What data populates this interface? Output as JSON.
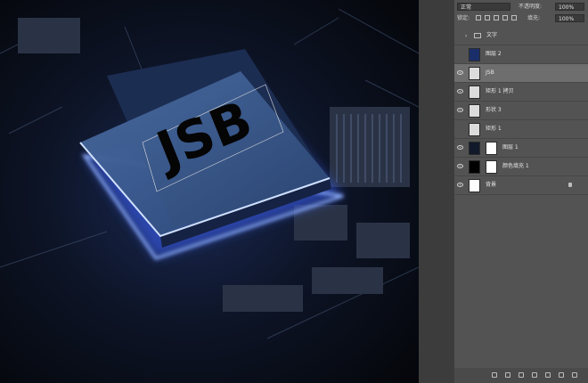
{
  "canvas": {
    "chip_text": "JSB",
    "glow_color": "#3d63ff"
  },
  "layers_panel": {
    "blend_mode": "正常",
    "opacity_label": "不透明度:",
    "opacity_value": "100%",
    "fill_label": "填充:",
    "fill_value": "100%",
    "layers": [
      {
        "name": "文字",
        "type": "group"
      },
      {
        "name": "图层 2",
        "type": "image"
      },
      {
        "name": "JSB",
        "type": "text",
        "selected": true
      },
      {
        "name": "矩形 1 拷贝",
        "type": "shape"
      },
      {
        "name": "形状 3",
        "type": "shape"
      },
      {
        "name": "矩形 1",
        "type": "shape"
      },
      {
        "name": "图层 1",
        "type": "image"
      },
      {
        "name": "颜色填充 1",
        "type": "fill"
      },
      {
        "name": "背景",
        "type": "background"
      }
    ]
  }
}
